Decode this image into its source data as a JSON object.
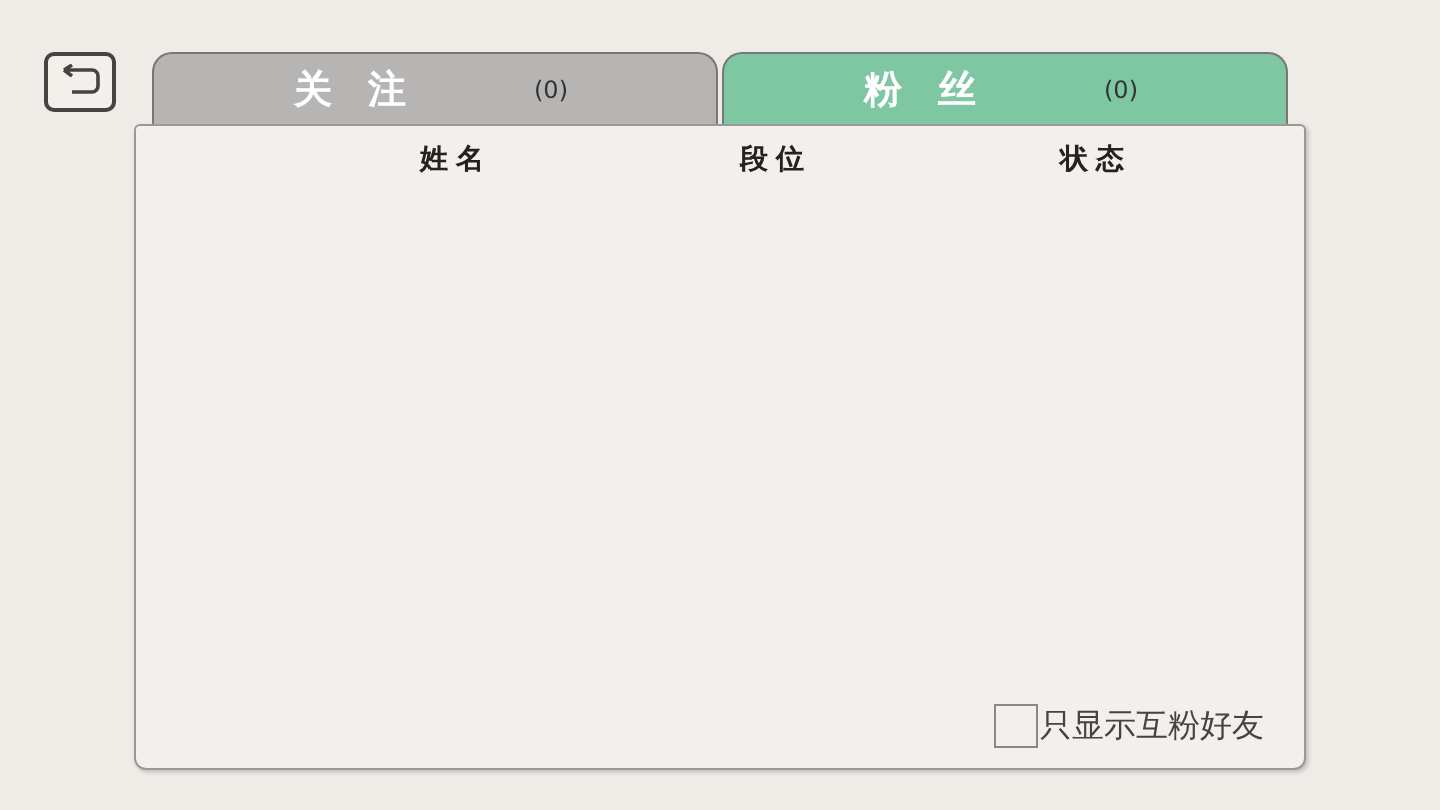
{
  "tabs": [
    {
      "label": "关注",
      "count": "(0)",
      "selected": false
    },
    {
      "label": "粉丝",
      "count": "(0)",
      "selected": true
    }
  ],
  "table": {
    "columns": [
      "姓名",
      "段位",
      "状态"
    ]
  },
  "filter": {
    "label": "只显示互粉好友",
    "checked": false
  }
}
